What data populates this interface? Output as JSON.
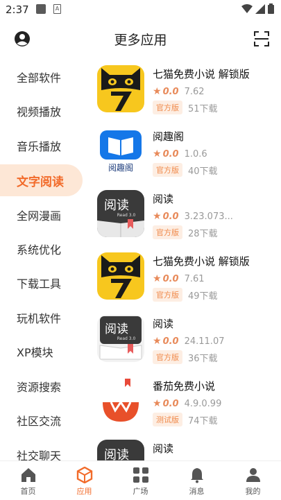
{
  "status": {
    "time": "2:37"
  },
  "header": {
    "title": "更多应用"
  },
  "categories": [
    {
      "label": "全部软件"
    },
    {
      "label": "视频播放"
    },
    {
      "label": "音乐播放"
    },
    {
      "label": "文字阅读",
      "active": true
    },
    {
      "label": "全网漫画"
    },
    {
      "label": "系统优化"
    },
    {
      "label": "下载工具"
    },
    {
      "label": "玩机软件"
    },
    {
      "label": "XP模块"
    },
    {
      "label": "资源搜索"
    },
    {
      "label": "社区交流"
    },
    {
      "label": "社交聊天"
    }
  ],
  "apps": [
    {
      "name": "七猫免费小说 解锁版",
      "score": "0.0",
      "version": "7.62",
      "tag": "官方版",
      "downloads": "51下载",
      "icon": "cat-icon"
    },
    {
      "name": "阅趣阁",
      "score": "0.0",
      "version": "1.0.6",
      "tag": "官方版",
      "downloads": "40下载",
      "icon": "book-icon",
      "icon_text": "阅趣阁"
    },
    {
      "name": "阅读",
      "score": "0.0",
      "version": "3.23.073...",
      "tag": "官方版",
      "downloads": "28下载",
      "icon": "read-icon",
      "icon_text": "阅读",
      "icon_sub": "Read 3.0"
    },
    {
      "name": "七猫免费小说 解锁版",
      "score": "0.0",
      "version": "7.61",
      "tag": "官方版",
      "downloads": "49下载",
      "icon": "cat-icon"
    },
    {
      "name": "阅读",
      "score": "0.0",
      "version": "24.11.07",
      "tag": "官方版",
      "downloads": "36下载",
      "icon": "read-icon-light",
      "icon_text": "阅读",
      "icon_sub": "Read 3.0"
    },
    {
      "name": "番茄免费小说",
      "score": "0.0",
      "version": "4.9.0.99",
      "tag": "测试版",
      "downloads": "74下载",
      "icon": "tomato-icon"
    },
    {
      "name": "阅读",
      "score": "",
      "version": "",
      "tag": "",
      "downloads": "",
      "icon": "read-icon",
      "icon_text": "阅读"
    }
  ],
  "nav": [
    {
      "label": "首页",
      "icon": "home-icon"
    },
    {
      "label": "应用",
      "icon": "apps-cube-icon",
      "active": true
    },
    {
      "label": "广场",
      "icon": "grid-icon"
    },
    {
      "label": "消息",
      "icon": "bell-icon"
    },
    {
      "label": "我的",
      "icon": "person-icon"
    }
  ],
  "colors": {
    "accent": "#f26b2a",
    "accent_bg": "#fde7d6",
    "tag_bg": "#fdeee3",
    "star": "#e88a5a"
  }
}
